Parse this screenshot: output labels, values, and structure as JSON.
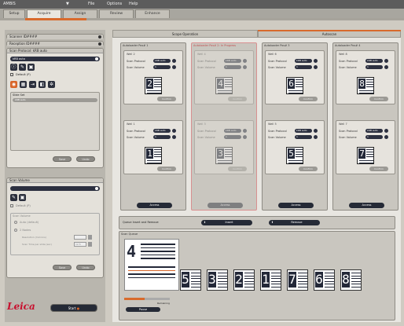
{
  "menubar": {
    "app": "AMBIS",
    "items": [
      "File",
      "Options",
      "Help"
    ]
  },
  "tabs": [
    "Setup",
    "Acquire",
    "Assign",
    "Review",
    "Enhance"
  ],
  "left": {
    "scanner": "Scanner ID####",
    "reception": "Reception ID####",
    "scan_protocol_title": "Scan Protocol: kRB auto",
    "protocol_value": "kRB auto",
    "default_label": "Default (P)",
    "slide_set_title": "Slide Set",
    "slide_set_value": "kRB auto",
    "save_label": "Save",
    "undo_label": "Undo",
    "scan_volume_title": "Scan Volume",
    "scan_default": "Default (P)",
    "scan_volume_sub": "Scan Volume",
    "mode1": "Auto (default)",
    "mode2": "2 Nodes",
    "field1": "Resolution (microns)",
    "field2": "Scan Time per slide (sec)",
    "field1_val": "",
    "field2_val": "12.5",
    "save2": "Save",
    "undo2": "Undo",
    "logo": "Leica",
    "start_label": "Start"
  },
  "main": {
    "header_left": "Scope Operation",
    "header_right": "Autoscan",
    "groups": [
      {
        "title": "Autoloader Pos# 1",
        "access": "Access",
        "wells": [
          {
            "label": "Well 2",
            "num": "2",
            "clean": "Confirm"
          },
          {
            "label": "Well 1",
            "num": "1",
            "clean": "Confirm"
          }
        ]
      },
      {
        "title": "Autoloader Pos# 2: In Progress",
        "access": "Access",
        "wells": [
          {
            "label": "Well 4",
            "num": "4",
            "clean": "Confirm"
          },
          {
            "label": "Well 3",
            "num": "3",
            "clean": "Confirm"
          }
        ]
      },
      {
        "title": "Autoloader Pos# 3",
        "access": "Access",
        "wells": [
          {
            "label": "Well 6",
            "num": "6",
            "clean": "Confirm"
          },
          {
            "label": "Well 5",
            "num": "5",
            "clean": "Confirm"
          }
        ]
      },
      {
        "title": "Autoloader Pos# 4",
        "access": "Access",
        "wells": [
          {
            "label": "Well 8",
            "num": "8",
            "clean": "Confirm"
          },
          {
            "label": "Well 7",
            "num": "7",
            "clean": "Confirm"
          }
        ]
      }
    ],
    "row1": "Scan Protocol",
    "row2": "Scan Volume",
    "row_value": "kRB auto",
    "row_value2": "1",
    "queue_bar_label": "Queue Insert and Remove",
    "insert_label": "Insert",
    "remove_label": "Remove",
    "scan_queue_title": "Scan Queue",
    "current": "4",
    "queue": [
      "5",
      "3",
      "2",
      "1",
      "7",
      "6",
      "8"
    ],
    "progress_label": "Remaining",
    "pause_label": "Pause"
  }
}
